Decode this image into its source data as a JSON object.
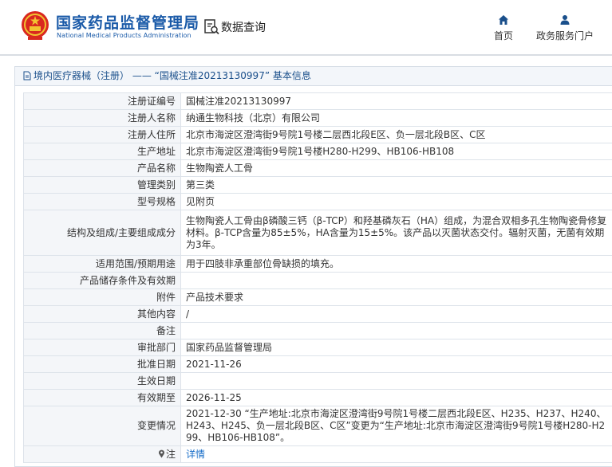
{
  "header": {
    "org_name": "国家药品监督管理局",
    "org_name_en": "National Medical Products Administration",
    "data_query": "数据查询",
    "nav": {
      "home": "首页",
      "service": "政务服务门户"
    }
  },
  "breadcrumb": "境内医疗器械（注册） —— “国械注准20213130997” 基本信息",
  "rows": [
    {
      "label": "注册证编号",
      "value": "国械注准20213130997"
    },
    {
      "label": "注册人名称",
      "value": "纳通生物科技（北京）有限公司"
    },
    {
      "label": "注册人住所",
      "value": "北京市海淀区澄湾街9号院1号楼二层西北段E区、负一层北段B区、C区"
    },
    {
      "label": "生产地址",
      "value": "北京市海淀区澄湾街9号院1号楼H280-H299、HB106-HB108"
    },
    {
      "label": "产品名称",
      "value": "生物陶瓷人工骨"
    },
    {
      "label": "管理类别",
      "value": "第三类"
    },
    {
      "label": "型号规格",
      "value": "见附页"
    },
    {
      "label": "结构及组成/主要组成成分",
      "value": "生物陶瓷人工骨由β磷酸三钙（β-TCP）和羟基磷灰石（HA）组成，为混合双相多孔生物陶瓷骨修复材料。β-TCP含量为85±5%，HA含量为15±5%。该产品以灭菌状态交付。辐射灭菌，无菌有效期为3年。"
    },
    {
      "label": "适用范围/预期用途",
      "value": "用于四肢非承重部位骨缺损的填充。"
    },
    {
      "label": "产品储存条件及有效期",
      "value": ""
    },
    {
      "label": "附件",
      "value": "产品技术要求"
    },
    {
      "label": "其他内容",
      "value": "/"
    },
    {
      "label": "备注",
      "value": ""
    },
    {
      "label": "审批部门",
      "value": "国家药品监督管理局"
    },
    {
      "label": "批准日期",
      "value": "2021-11-26"
    },
    {
      "label": "生效日期",
      "value": ""
    },
    {
      "label": "有效期至",
      "value": "2026-11-25"
    },
    {
      "label": "变更情况",
      "value": "2021-12-30 “生产地址:北京市海淀区澄湾街9号院1号楼二层西北段E区、H235、H237、H240、H243、H245、负一层北段B区、C区”变更为“生产地址:北京市海淀区澄湾街9号院1号楼H280-H299、HB106-HB108”。"
    },
    {
      "label": "注",
      "value": "详情"
    }
  ]
}
